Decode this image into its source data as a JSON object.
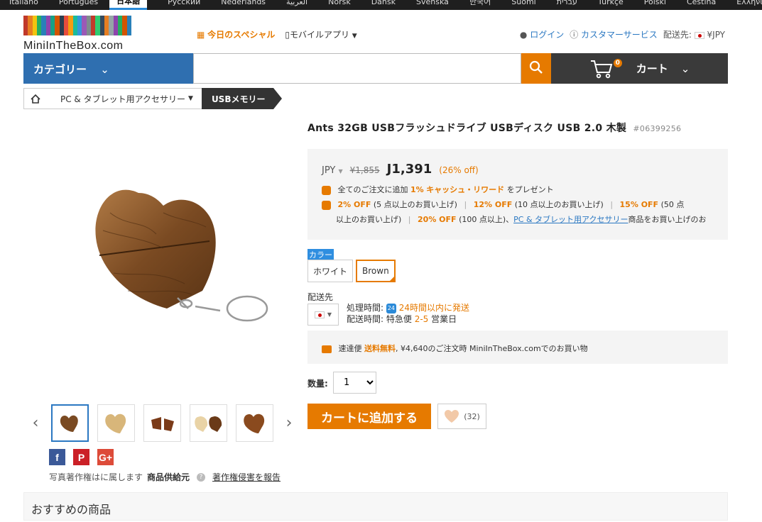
{
  "languages": [
    "Italiano",
    "Português",
    "日本語",
    "Русский",
    "Nederlands",
    "العربية",
    "Norsk",
    "Dansk",
    "Svenska",
    "한국어",
    "Suomi",
    "עברית",
    "Türkçe",
    "Polski",
    "Čeština",
    "Ελληνικά"
  ],
  "active_language_index": 2,
  "header": {
    "logo_text": "MiniInTheBox.com",
    "special": "今日のスペシャル",
    "mobile_app": "モバイルアプリ",
    "login": "ログイン",
    "customer_service": "カスタマーサービス",
    "ship_to": "配送先:",
    "currency": "¥JPY"
  },
  "nav": {
    "category": "カテゴリー",
    "search_placeholder": "",
    "cart": "カート",
    "cart_count": "0"
  },
  "breadcrumb": {
    "level1": "PC & タブレット用アクセサリー",
    "level2": "USBメモリー"
  },
  "product": {
    "title": "Ants 32GB USBフラッシュドライブ USBディスク USB 2.0 木製",
    "sku": "#06399256",
    "currency": "JPY",
    "old_price": "¥1,855",
    "new_price": "J1,391",
    "discount": "(26% off)",
    "cashback_pre": "全てのご注文に追加",
    "cashback_pct": "1%",
    "cashback_name": "キャッシュ・リワード",
    "cashback_post": "をプレゼント",
    "tier1_off": "2% OFF",
    "tier1_cond": "(5 点以上のお買い上げ)",
    "tier2_off": "12% OFF",
    "tier2_cond": "(10 点以上のお買い上げ)",
    "tier3_off": "15% OFF",
    "tier3_cond": "(50 点",
    "tier3_cond2": "以上のお買い上げ)",
    "tier4_off": "20% OFF",
    "tier4_cond": "(100 点以上)、",
    "tier4_link": "PC & タブレット用アクセサリー",
    "tier4_post": "商品をお買い上げのお",
    "color_label": "カラー",
    "colors": [
      "ホワイト",
      "Brown"
    ],
    "ship_label": "配送先",
    "processing_label": "処理時間:",
    "processing_badge": "24",
    "processing_value": "24時間以内に発送",
    "delivery_label": "配送時間:",
    "delivery_type": "特急便",
    "delivery_days": "2-5",
    "delivery_unit": "営業日",
    "free_pre": "速達便",
    "free_label": "送料無料",
    "free_post": ", ¥4,640のご注文時 MiniInTheBox.comでのお買い物",
    "qty_label": "数量:",
    "qty_value": "1",
    "add_to_cart": "カートに追加する",
    "wish_count": "(32)"
  },
  "gallery": {
    "credit_pre": "写真著作権はに属します",
    "credit_owner": "商品供給元",
    "report": "著作権侵害を報告"
  },
  "social": [
    "f",
    "P",
    "G+"
  ],
  "recommend": "おすすめの商品",
  "colors": {
    "accent": "#e67a00",
    "nav_blue": "#2f6fb0",
    "link": "#2b78c2"
  }
}
